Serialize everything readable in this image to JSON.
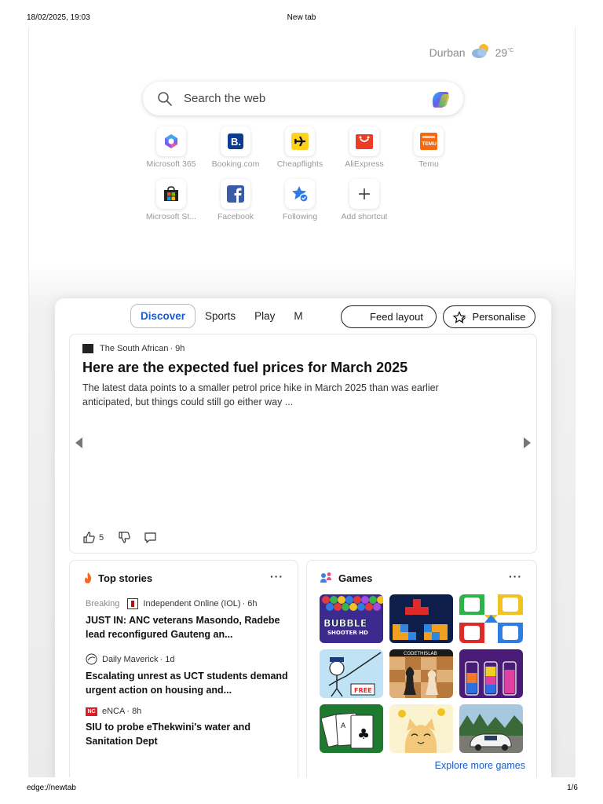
{
  "print": {
    "datetime": "18/02/2025, 19:03",
    "title": "New tab",
    "url": "edge://newtab",
    "page": "1/6"
  },
  "weather": {
    "city": "Durban",
    "temp": "29",
    "unit": "°C",
    "icon": "partly-cloudy-icon"
  },
  "search": {
    "placeholder": "Search the web",
    "icon": "search-icon",
    "assistant_icon": "copilot-icon"
  },
  "shortcuts": [
    {
      "label": "Microsoft 365",
      "icon": "microsoft-365-icon"
    },
    {
      "label": "Booking.com",
      "icon": "booking-icon"
    },
    {
      "label": "Cheapflights",
      "icon": "cheapflights-icon"
    },
    {
      "label": "AliExpress",
      "icon": "aliexpress-icon"
    },
    {
      "label": "Temu",
      "icon": "temu-icon"
    },
    {
      "label": "Microsoft St...",
      "icon": "microsoft-store-icon"
    },
    {
      "label": "Facebook",
      "icon": "facebook-icon"
    },
    {
      "label": "Following",
      "icon": "following-icon"
    },
    {
      "label": "Add shortcut",
      "icon": "plus-icon"
    }
  ],
  "feed": {
    "tabs": [
      "Discover",
      "Sports",
      "Play",
      "M"
    ],
    "active_tab": "Discover",
    "feed_layout_label": "Feed layout",
    "personalise_label": "Personalise",
    "main_story": {
      "source": "The South African",
      "age": "· 9h",
      "headline": "Here are the expected fuel prices for March 2025",
      "summary": "The latest data points to a smaller petrol price hike in March 2025 than was earlier anticipated, but things could still go either way ...",
      "likes": "5"
    },
    "top_stories": {
      "heading": "Top stories",
      "more": "···",
      "items": [
        {
          "tag": "Breaking",
          "source": "Independent Online (IOL)",
          "age": "· 6h",
          "title": "JUST IN: ANC veterans Masondo, Radebe lead reconfigured Gauteng an..."
        },
        {
          "tag": "",
          "source": "Daily Maverick",
          "age": "· 1d",
          "title": "Escalating unrest as UCT students demand urgent action on housing and..."
        },
        {
          "tag": "",
          "source": "eNCA",
          "age": "· 8h",
          "title": "SIU to probe eThekwini's water and Sanitation Dept"
        }
      ]
    },
    "games": {
      "heading": "Games",
      "more": "···",
      "explore_label": "Explore more games",
      "tiles": [
        {
          "name": "bubble-shooter",
          "text": "BUBBLE SHOOTER HD"
        },
        {
          "name": "block-puzzle",
          "text": ""
        },
        {
          "name": "ludo",
          "text": ""
        },
        {
          "name": "stickman-puzzle",
          "text": "FREE"
        },
        {
          "name": "chess",
          "text": "CODETHISLAB"
        },
        {
          "name": "water-sort",
          "text": ""
        },
        {
          "name": "solitaire",
          "text": ""
        },
        {
          "name": "cat-game",
          "text": ""
        },
        {
          "name": "car-racing",
          "text": ""
        }
      ]
    }
  }
}
